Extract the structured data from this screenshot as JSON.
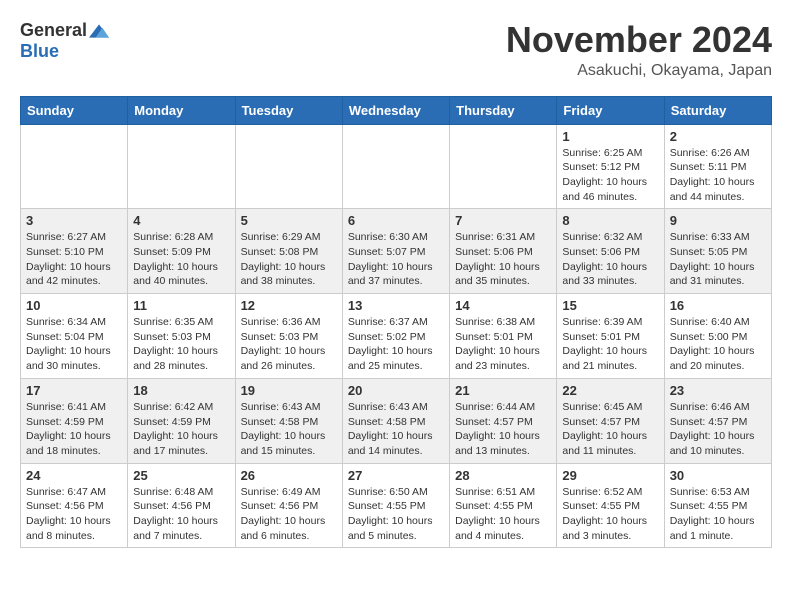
{
  "header": {
    "logo_general": "General",
    "logo_blue": "Blue",
    "month": "November 2024",
    "location": "Asakuchi, Okayama, Japan"
  },
  "weekdays": [
    "Sunday",
    "Monday",
    "Tuesday",
    "Wednesday",
    "Thursday",
    "Friday",
    "Saturday"
  ],
  "weeks": [
    [
      {
        "day": "",
        "info": ""
      },
      {
        "day": "",
        "info": ""
      },
      {
        "day": "",
        "info": ""
      },
      {
        "day": "",
        "info": ""
      },
      {
        "day": "",
        "info": ""
      },
      {
        "day": "1",
        "info": "Sunrise: 6:25 AM\nSunset: 5:12 PM\nDaylight: 10 hours and 46 minutes."
      },
      {
        "day": "2",
        "info": "Sunrise: 6:26 AM\nSunset: 5:11 PM\nDaylight: 10 hours and 44 minutes."
      }
    ],
    [
      {
        "day": "3",
        "info": "Sunrise: 6:27 AM\nSunset: 5:10 PM\nDaylight: 10 hours and 42 minutes."
      },
      {
        "day": "4",
        "info": "Sunrise: 6:28 AM\nSunset: 5:09 PM\nDaylight: 10 hours and 40 minutes."
      },
      {
        "day": "5",
        "info": "Sunrise: 6:29 AM\nSunset: 5:08 PM\nDaylight: 10 hours and 38 minutes."
      },
      {
        "day": "6",
        "info": "Sunrise: 6:30 AM\nSunset: 5:07 PM\nDaylight: 10 hours and 37 minutes."
      },
      {
        "day": "7",
        "info": "Sunrise: 6:31 AM\nSunset: 5:06 PM\nDaylight: 10 hours and 35 minutes."
      },
      {
        "day": "8",
        "info": "Sunrise: 6:32 AM\nSunset: 5:06 PM\nDaylight: 10 hours and 33 minutes."
      },
      {
        "day": "9",
        "info": "Sunrise: 6:33 AM\nSunset: 5:05 PM\nDaylight: 10 hours and 31 minutes."
      }
    ],
    [
      {
        "day": "10",
        "info": "Sunrise: 6:34 AM\nSunset: 5:04 PM\nDaylight: 10 hours and 30 minutes."
      },
      {
        "day": "11",
        "info": "Sunrise: 6:35 AM\nSunset: 5:03 PM\nDaylight: 10 hours and 28 minutes."
      },
      {
        "day": "12",
        "info": "Sunrise: 6:36 AM\nSunset: 5:03 PM\nDaylight: 10 hours and 26 minutes."
      },
      {
        "day": "13",
        "info": "Sunrise: 6:37 AM\nSunset: 5:02 PM\nDaylight: 10 hours and 25 minutes."
      },
      {
        "day": "14",
        "info": "Sunrise: 6:38 AM\nSunset: 5:01 PM\nDaylight: 10 hours and 23 minutes."
      },
      {
        "day": "15",
        "info": "Sunrise: 6:39 AM\nSunset: 5:01 PM\nDaylight: 10 hours and 21 minutes."
      },
      {
        "day": "16",
        "info": "Sunrise: 6:40 AM\nSunset: 5:00 PM\nDaylight: 10 hours and 20 minutes."
      }
    ],
    [
      {
        "day": "17",
        "info": "Sunrise: 6:41 AM\nSunset: 4:59 PM\nDaylight: 10 hours and 18 minutes."
      },
      {
        "day": "18",
        "info": "Sunrise: 6:42 AM\nSunset: 4:59 PM\nDaylight: 10 hours and 17 minutes."
      },
      {
        "day": "19",
        "info": "Sunrise: 6:43 AM\nSunset: 4:58 PM\nDaylight: 10 hours and 15 minutes."
      },
      {
        "day": "20",
        "info": "Sunrise: 6:43 AM\nSunset: 4:58 PM\nDaylight: 10 hours and 14 minutes."
      },
      {
        "day": "21",
        "info": "Sunrise: 6:44 AM\nSunset: 4:57 PM\nDaylight: 10 hours and 13 minutes."
      },
      {
        "day": "22",
        "info": "Sunrise: 6:45 AM\nSunset: 4:57 PM\nDaylight: 10 hours and 11 minutes."
      },
      {
        "day": "23",
        "info": "Sunrise: 6:46 AM\nSunset: 4:57 PM\nDaylight: 10 hours and 10 minutes."
      }
    ],
    [
      {
        "day": "24",
        "info": "Sunrise: 6:47 AM\nSunset: 4:56 PM\nDaylight: 10 hours and 8 minutes."
      },
      {
        "day": "25",
        "info": "Sunrise: 6:48 AM\nSunset: 4:56 PM\nDaylight: 10 hours and 7 minutes."
      },
      {
        "day": "26",
        "info": "Sunrise: 6:49 AM\nSunset: 4:56 PM\nDaylight: 10 hours and 6 minutes."
      },
      {
        "day": "27",
        "info": "Sunrise: 6:50 AM\nSunset: 4:55 PM\nDaylight: 10 hours and 5 minutes."
      },
      {
        "day": "28",
        "info": "Sunrise: 6:51 AM\nSunset: 4:55 PM\nDaylight: 10 hours and 4 minutes."
      },
      {
        "day": "29",
        "info": "Sunrise: 6:52 AM\nSunset: 4:55 PM\nDaylight: 10 hours and 3 minutes."
      },
      {
        "day": "30",
        "info": "Sunrise: 6:53 AM\nSunset: 4:55 PM\nDaylight: 10 hours and 1 minute."
      }
    ]
  ]
}
